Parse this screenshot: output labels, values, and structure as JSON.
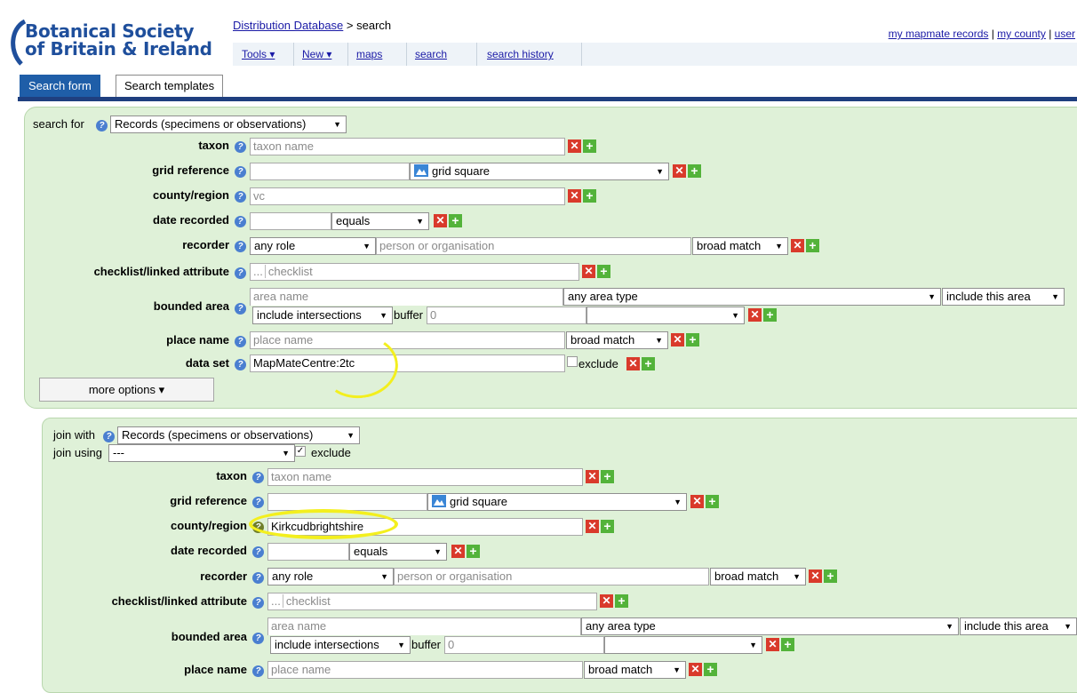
{
  "logo": {
    "line1": "Botanical Society",
    "line2": "of Britain & Ireland"
  },
  "breadcrumb": {
    "link": "Distribution Database",
    "rest": " > search"
  },
  "nav": {
    "tools": "Tools ▾",
    "new": "New ▾",
    "maps": "maps",
    "search": "search",
    "history": "search history"
  },
  "userlinks": {
    "mapmate": "my mapmate records",
    "sep1": " | ",
    "county": "my county",
    "sep2": " | ",
    "user": "user"
  },
  "tabs": {
    "search_form": "Search form",
    "templates": "Search templates"
  },
  "colors": {
    "accent": "#1f5ea8",
    "panel": "#dff1d8",
    "highlight": "#f3ef1e"
  },
  "form1": {
    "search_for_label": "search for",
    "search_for_value": "Records (specimens or observations)",
    "taxon_label": "taxon",
    "taxon_placeholder": "taxon name",
    "grid_label": "grid reference",
    "grid_square": "grid square",
    "county_label": "county/region",
    "county_placeholder": "vc",
    "date_label": "date recorded",
    "date_op": "equals",
    "recorder_label": "recorder",
    "recorder_role": "any role",
    "recorder_placeholder": "person or organisation",
    "recorder_match": "broad match",
    "checklist_label": "checklist/linked attribute",
    "checklist_dots": "...",
    "checklist_placeholder": "checklist",
    "bounded_label": "bounded area",
    "area_placeholder": "area name",
    "area_type": "any area type",
    "include_area": "include this area",
    "intersections": "include intersections",
    "buffer_label": "buffer",
    "buffer_value": "0",
    "place_label": "place name",
    "place_placeholder": "place name",
    "place_match": "broad match",
    "dataset_label": "data set",
    "dataset_value": "MapMateCentre:2tc",
    "exclude_label": "exclude",
    "more_options": "more options ▾"
  },
  "form2": {
    "join_with_label": "join with",
    "join_with_value": "Records (specimens or observations)",
    "join_using_label": "join using",
    "join_using_value": "---",
    "exclude_label": "exclude",
    "taxon_label": "taxon",
    "taxon_placeholder": "taxon name",
    "grid_label": "grid reference",
    "grid_square": "grid square",
    "county_label": "county/region",
    "county_value": "Kirkcudbrightshire",
    "date_label": "date recorded",
    "date_op": "equals",
    "recorder_label": "recorder",
    "recorder_role": "any role",
    "recorder_placeholder": "person or organisation",
    "recorder_match": "broad match",
    "checklist_label": "checklist/linked attribute",
    "checklist_dots": "...",
    "checklist_placeholder": "checklist",
    "bounded_label": "bounded area",
    "area_placeholder": "area name",
    "area_type": "any area type",
    "include_area": "include this area",
    "intersections": "include intersections",
    "buffer_label": "buffer",
    "buffer_value": "0",
    "place_label": "place name",
    "place_placeholder": "place name",
    "place_match": "broad match"
  }
}
